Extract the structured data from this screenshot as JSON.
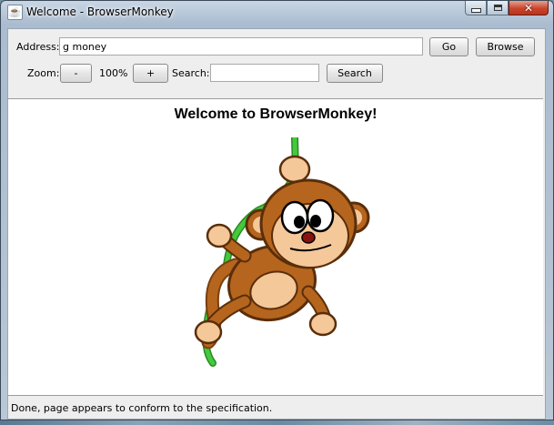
{
  "window": {
    "title": "Welcome - BrowserMonkey",
    "app_icon_glyph": "☕",
    "controls": {
      "minimize": "minimize-icon",
      "maximize": "maximize-icon",
      "close": "close-icon",
      "close_glyph": "✕"
    }
  },
  "toolbar": {
    "address_label": "Address:",
    "address_value": "g money",
    "go_label": "Go",
    "browse_label": "Browse",
    "zoom_label": "Zoom:",
    "zoom_out_label": "-",
    "zoom_level": "100%",
    "zoom_in_label": "+",
    "search_label": "Search:",
    "search_value": "",
    "search_button_label": "Search"
  },
  "page": {
    "heading": "Welcome to BrowserMonkey!",
    "image": "monkey-on-vine-illustration"
  },
  "status": {
    "text": "Done, page appears to conform to the specification."
  },
  "colors": {
    "monkey_fur": "#b5651d",
    "monkey_face": "#f5c89a",
    "vine": "#3ab534",
    "close_button": "#c9452c"
  }
}
